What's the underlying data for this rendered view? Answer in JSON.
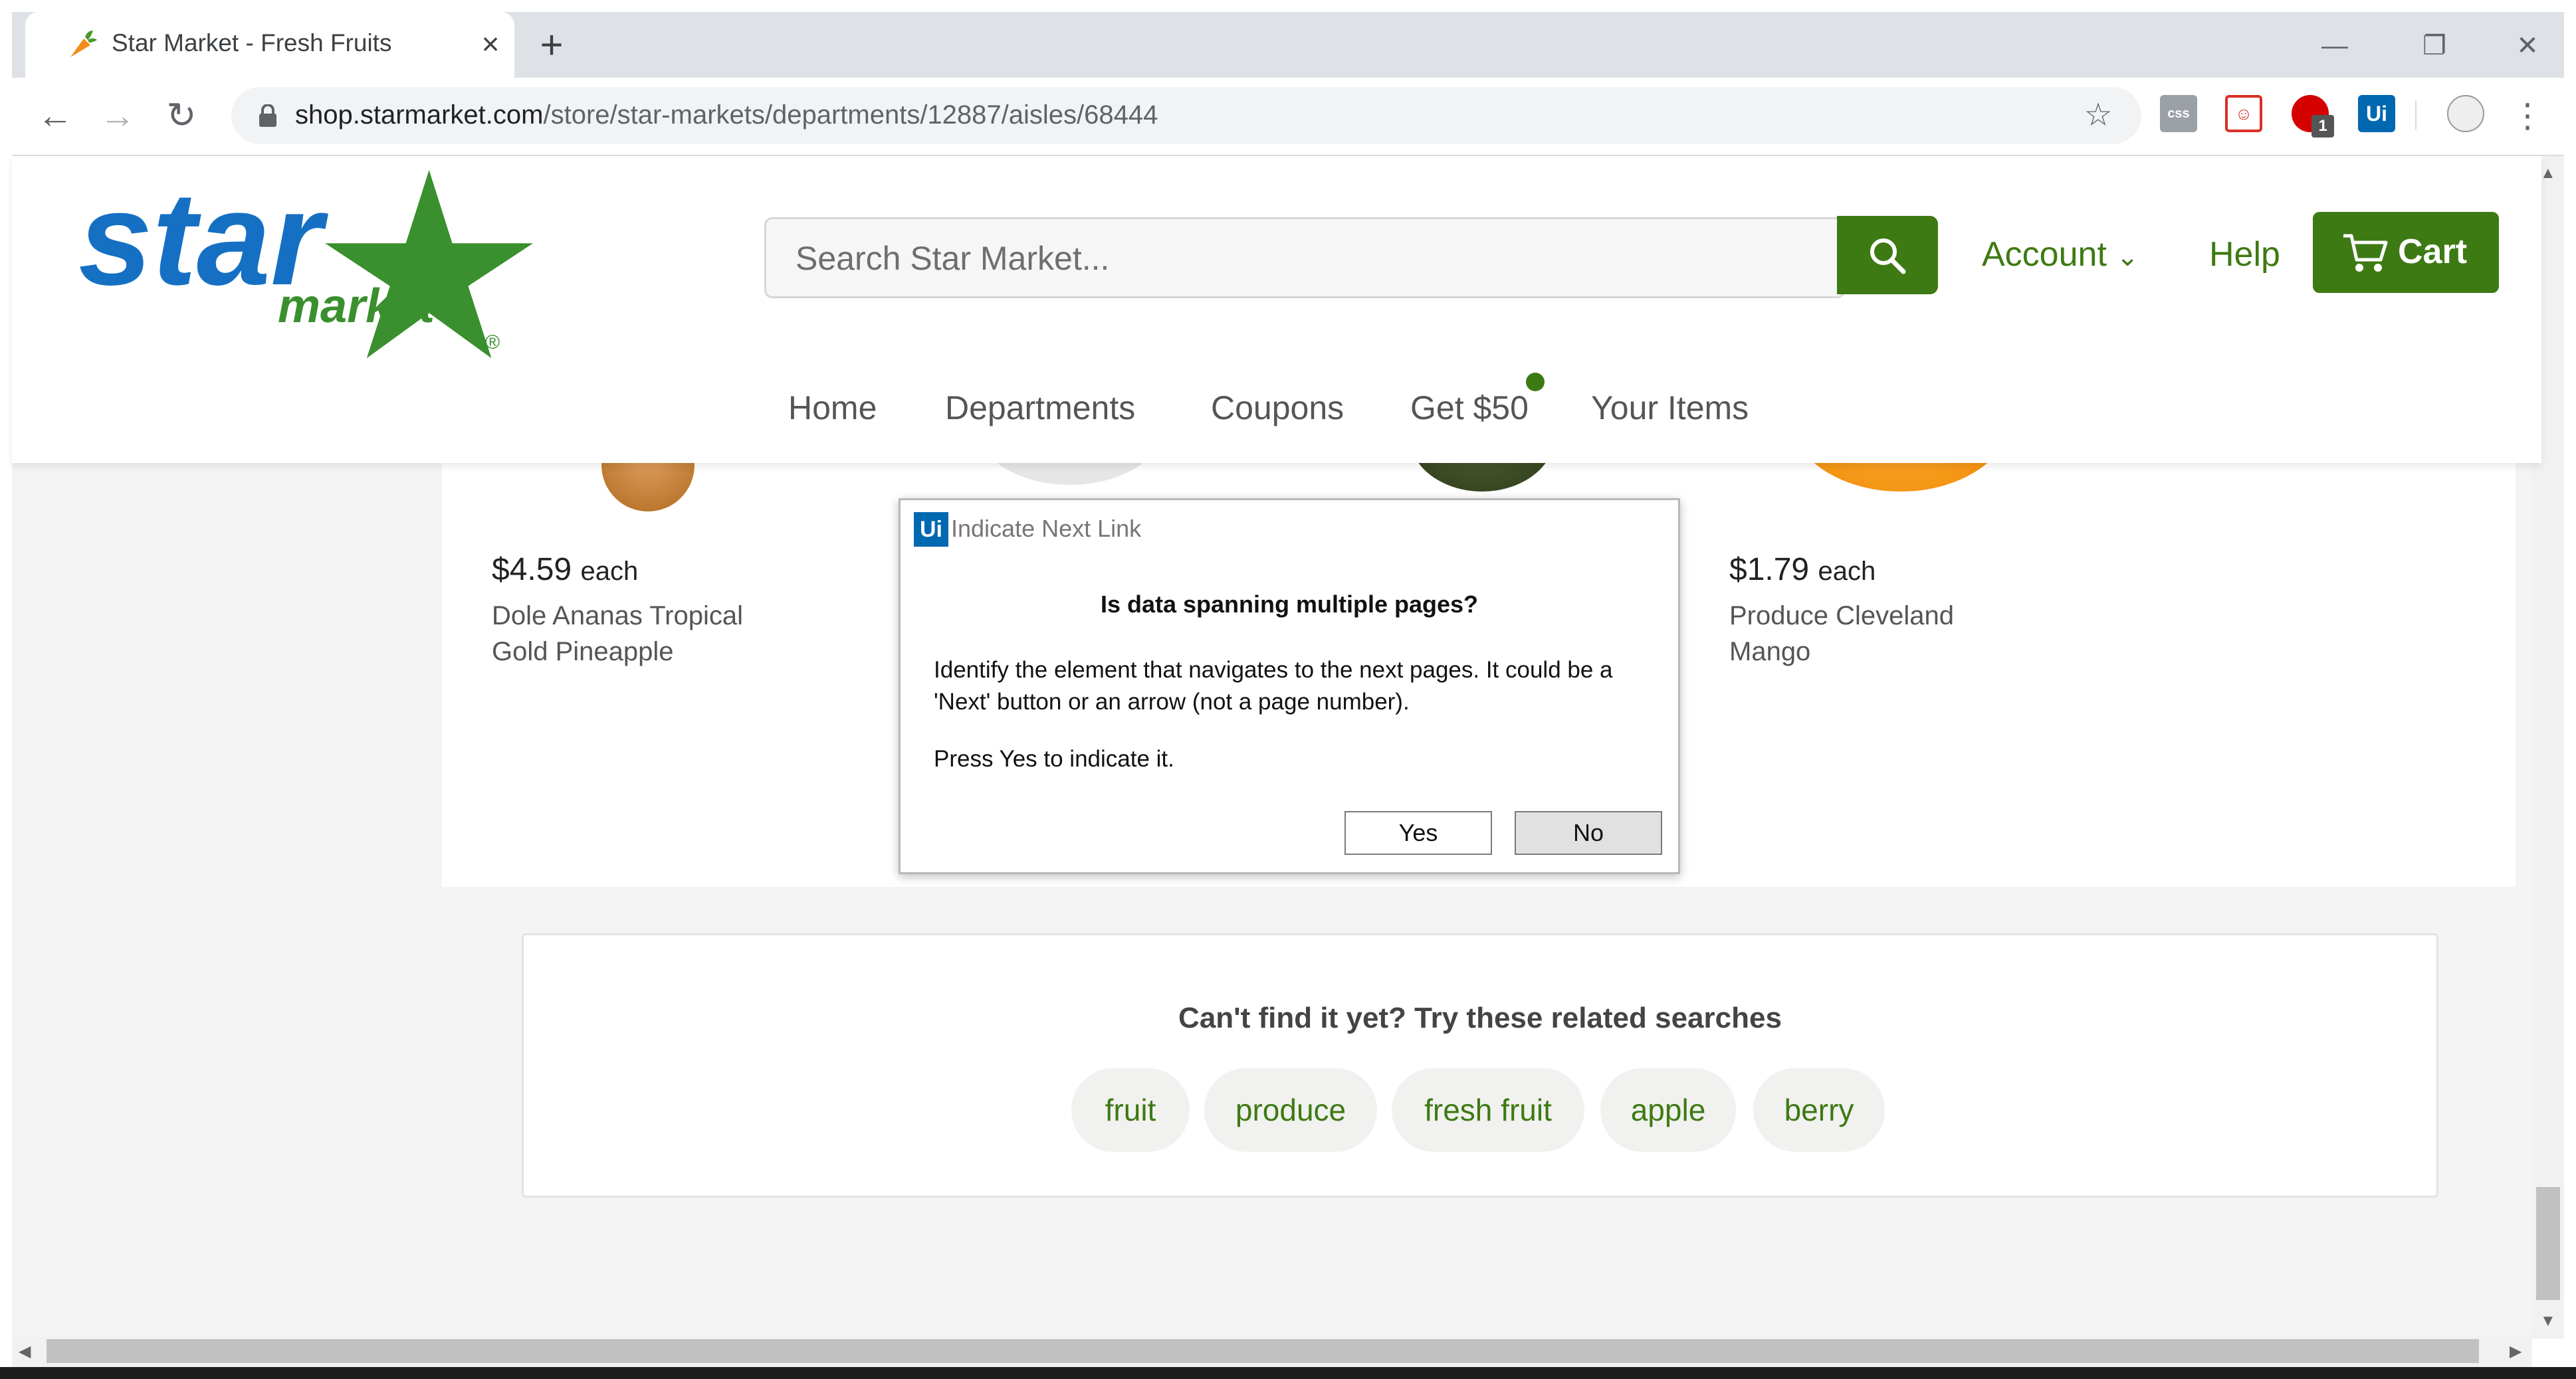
{
  "browser": {
    "tab_title": "Star Market - Fresh Fruits",
    "url_domain": "shop.starmarket.com",
    "url_path": "/store/star-markets/departments/12887/aisles/68444",
    "extensions": [
      "css-extension-icon",
      "ext-red-icon",
      "ext-badge-icon",
      "uipath-extension-icon",
      "avatar-icon"
    ],
    "extension_badge": "1",
    "uipath_ext_label": "Ui",
    "css_ext_label": "css"
  },
  "header": {
    "logo_text_star": "star",
    "logo_text_market": "market",
    "logo_reg": "®",
    "search_placeholder": "Search Star  Market...",
    "account_label": "Account",
    "help_label": "Help",
    "cart_label": "Cart",
    "nav": [
      "Home",
      "Departments",
      "Coupons",
      "Get $50",
      "Your Items"
    ]
  },
  "products": [
    {
      "price": "$4.59",
      "unit": "each",
      "name_line1": "Dole Ananas Tropical",
      "name_line2": "Gold Pineapple"
    },
    {
      "price": "$1.79",
      "unit": "each",
      "name_line1": "Produce Cleveland",
      "name_line2": "Mango"
    }
  ],
  "related": {
    "title": "Can't find it yet? Try these related searches",
    "chips": [
      "fruit",
      "produce",
      "fresh fruit",
      "apple",
      "berry"
    ]
  },
  "dialog": {
    "icon_label": "Ui",
    "title": "Indicate Next Link",
    "question": "Is data spanning multiple pages?",
    "body": "Identify the element that navigates to the next pages. It could be a 'Next' button or an arrow (not a page number).",
    "press": "Press Yes to indicate it.",
    "yes_label": "Yes",
    "no_label": "No"
  },
  "colors": {
    "brand_green": "#3e7a13",
    "brand_blue": "#1570c4",
    "uipath_blue": "#0067b1"
  }
}
